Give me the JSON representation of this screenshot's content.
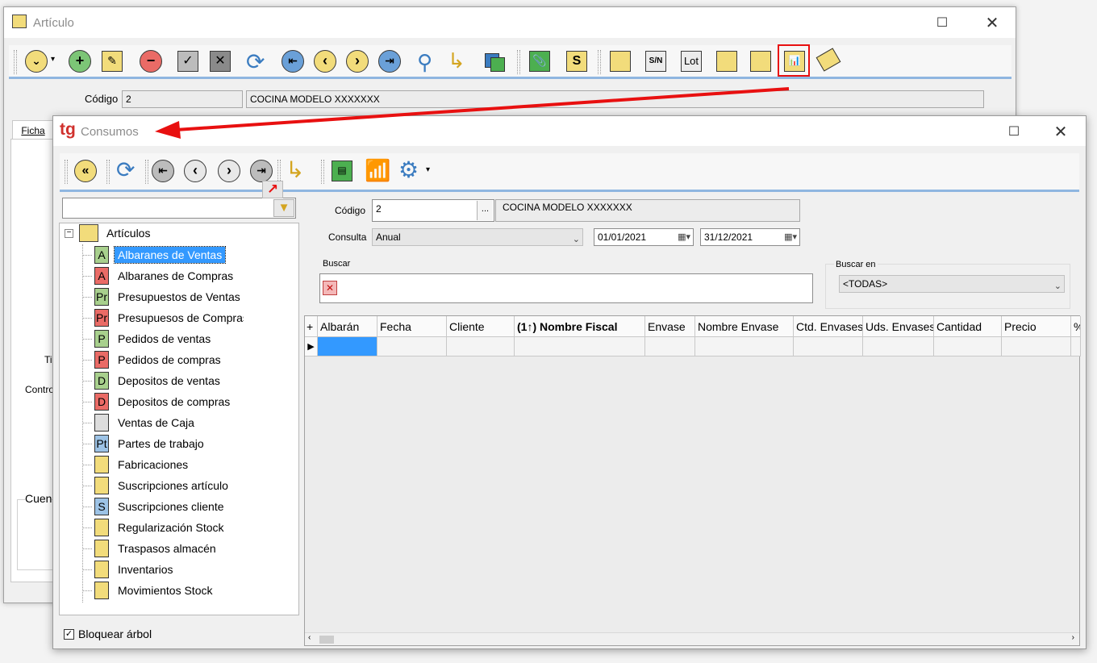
{
  "articulo_window": {
    "title": "Artículo",
    "codigo_label": "Código",
    "codigo_value": "2",
    "descripcion_value": "COCINA MODELO XXXXXXX",
    "tab_ficha": "Ficha",
    "side_label_tipo": "Tip",
    "side_label_control": "Contro",
    "side_label_cuenta": "Cuen",
    "toolbar_lot": "Lot",
    "toolbar_sn": "S/N"
  },
  "consumos_window": {
    "logo": "tg",
    "title": "Consumos",
    "codigo_label": "Código",
    "codigo_value": "2",
    "codigo_browse": "...",
    "descripcion_value": "COCINA MODELO XXXXXXX",
    "consulta_label": "Consulta",
    "consulta_value": "Anual",
    "fecha_desde": "01/01/2021",
    "fecha_hasta": "31/12/2021",
    "buscar_label": "Buscar",
    "buscar_en_label": "Buscar en",
    "buscar_en_value": "<TODAS>",
    "bloquear_label": "Bloquear árbol",
    "tree_root": "Artículos",
    "tree_items": [
      {
        "label": "Albaranes de Ventas",
        "icon": "A",
        "color": "#a8d08d"
      },
      {
        "label": "Albaranes de Compras",
        "icon": "A",
        "color": "#ea6b66"
      },
      {
        "label": "Presupuestos de Ventas",
        "icon": "Pr",
        "color": "#a8d08d"
      },
      {
        "label": "Presupuesos de Compras",
        "icon": "Pr",
        "color": "#ea6b66"
      },
      {
        "label": "Pedidos de ventas",
        "icon": "P",
        "color": "#a8d08d"
      },
      {
        "label": "Pedidos de compras",
        "icon": "P",
        "color": "#ea6b66"
      },
      {
        "label": "Depositos de ventas",
        "icon": "D",
        "color": "#a8d08d"
      },
      {
        "label": "Depositos de compras",
        "icon": "D",
        "color": "#ea6b66"
      },
      {
        "label": "Ventas de Caja",
        "icon": "",
        "color": "#dddddd"
      },
      {
        "label": "Partes de trabajo",
        "icon": "Pt",
        "color": "#9dc3e6"
      },
      {
        "label": "Fabricaciones",
        "icon": "",
        "color": "#f2dc7b"
      },
      {
        "label": "Suscripciones artículo",
        "icon": "",
        "color": "#f2dc7b"
      },
      {
        "label": "Suscripciones cliente",
        "icon": "S",
        "color": "#9dc3e6"
      },
      {
        "label": "Regularización Stock",
        "icon": "",
        "color": "#f2dc7b"
      },
      {
        "label": "Traspasos almacén",
        "icon": "",
        "color": "#f2dc7b"
      },
      {
        "label": "Inventarios",
        "icon": "",
        "color": "#f2dc7b"
      },
      {
        "label": "Movimientos Stock",
        "icon": "",
        "color": "#f2dc7b"
      }
    ],
    "grid_add": "+",
    "grid_columns": [
      "Albarán",
      "Fecha",
      "Cliente",
      "(1↑) Nombre Fiscal",
      "Envase",
      "Nombre Envase",
      "Ctd. Envases",
      "Uds. Envases",
      "Cantidad",
      "Precio",
      "%"
    ]
  },
  "colors": {
    "accent_blue": "#8fb6e0",
    "selection": "#3399ff",
    "annotation_red": "#e81010"
  }
}
